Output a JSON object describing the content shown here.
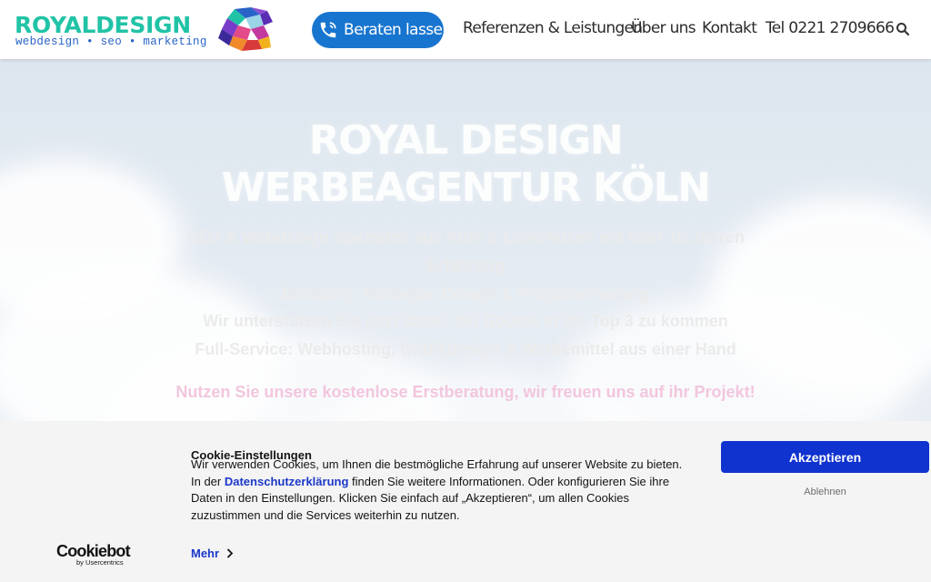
{
  "header": {
    "logo_word": "ROYALDESIGN",
    "logo_tagline": "webdesign • seo • marketing",
    "cta_label": "Beraten lassen",
    "nav": [
      "Referenzen & Leistungen",
      "Über uns",
      "Kontakt",
      "Tel 0221 2709666"
    ],
    "icons": {
      "phone": "phone-icon",
      "search": "search-icon",
      "logo": "lion-icon"
    }
  },
  "hero": {
    "title_line1": "ROYAL DESIGN",
    "title_line2": "WERBEAGENTUR KÖLN",
    "lines": [
      "SEO & Webdesign Spezialist aus Köln & Leverkusen mit über 16 Jahren",
      "Erfahrung",
      "Beratung, Strategie, Design & Programmierung",
      "Wir unterstützen Sie jetzt dabei, bei Google in die Top 3 zu kommen",
      "Full-Service: Webhosting, Grafikdesign & Werbemittel aus einer Hand"
    ],
    "cta": "Nutzen Sie unsere kostenlose Erstberatung, wir freuen uns auf ihr Projekt!"
  },
  "cookie": {
    "title": "Cookie-Einstellungen",
    "line1": "Wir verwenden Cookies, um Ihnen die bestmögliche Erfahrung auf unserer Website zu bieten.",
    "line2_prefix": "In der ",
    "link": "Datenschutzerklärung",
    "line2_suffix": " finden Sie weitere Informationen. Oder konfigurieren Sie ihre",
    "line3": "Daten in den Einstellungen. Klicken Sie einfach auf „Akzeptieren“, um allen Cookies",
    "line4": "zuzustimmen und die Services weiterhin zu nutzen.",
    "more": "Mehr",
    "accept": "Akzeptieren",
    "decline": "Ablehnen",
    "brand": "Cookiebot",
    "brand_sub": "by Usercentrics"
  },
  "colors": {
    "logo_teal": "#21c3a6",
    "tagline_blue": "#2a63c8",
    "cta_blue": "#1875cf",
    "accept_blue": "#1032cf",
    "link_blue": "#1a38c9",
    "hero_pink": "#f2c6de"
  }
}
